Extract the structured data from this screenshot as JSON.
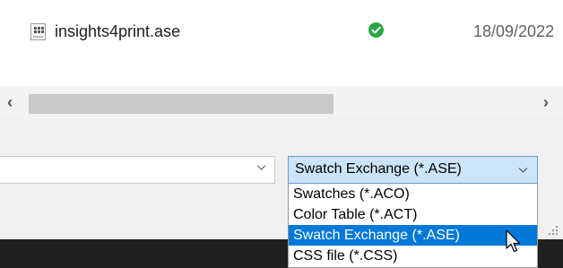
{
  "file_row": {
    "name": "insights4print.ase",
    "status": "ok",
    "date": "18/09/2022"
  },
  "scrollbar": {
    "left_arrow": "‹",
    "right_arrow": "›"
  },
  "save_dialog": {
    "filename_value": "",
    "filetype_selected": "Swatch Exchange (*.ASE)",
    "filetype_options": [
      "Swatches (*.ACO)",
      "Color Table (*.ACT)",
      "Swatch Exchange (*.ASE)",
      "CSS file (*.CSS)"
    ],
    "highlighted_index": 2
  },
  "colors": {
    "selection": "#0078d7",
    "combo_focus": "#cce4f7",
    "status_ok": "#27a844",
    "taskbar": "#202020"
  },
  "icons": {
    "file": "swatch-file-icon",
    "status": "check-circle-icon",
    "combo": "chevron-down-icon",
    "cursor": "mouse-pointer-icon"
  }
}
